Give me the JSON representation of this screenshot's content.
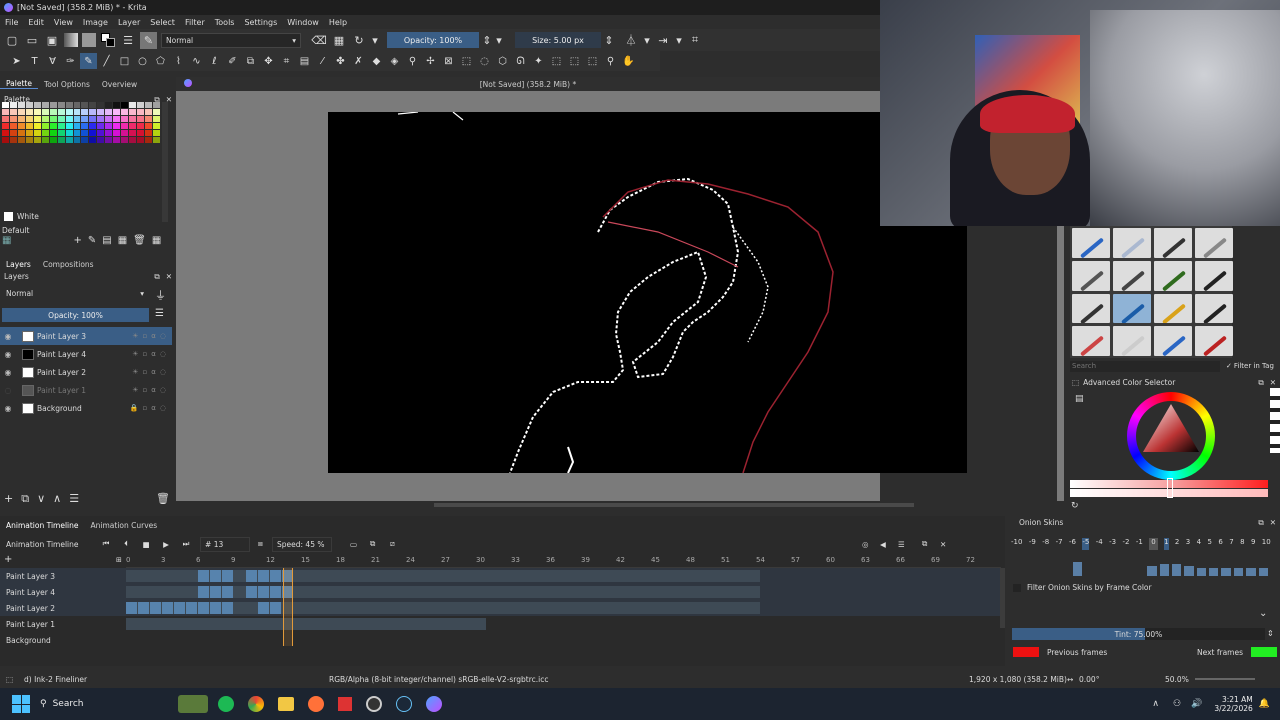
{
  "window": {
    "title": "[Not Saved]  (358.2 MiB) * - Krita"
  },
  "menu": [
    "File",
    "Edit",
    "View",
    "Image",
    "Layer",
    "Select",
    "Filter",
    "Tools",
    "Settings",
    "Window",
    "Help"
  ],
  "toolbar": {
    "blend_mode": "Normal",
    "opacity": "Opacity: 100%",
    "size": "Size: 5.00 px"
  },
  "docker_tabs": [
    "Palette",
    "Tool Options",
    "Overview"
  ],
  "palette": {
    "title": "Palette",
    "current_color": "White",
    "palette_name": "Default"
  },
  "layers_tabs": [
    "Layers",
    "Compositions"
  ],
  "layers_panel": {
    "title": "Layers",
    "blend": "Normal",
    "opacity": "Opacity: 100%"
  },
  "layers": [
    {
      "name": "Paint Layer 3",
      "active": true,
      "visible": true
    },
    {
      "name": "Paint Layer 4",
      "active": false,
      "visible": true
    },
    {
      "name": "Paint Layer 2",
      "active": false,
      "visible": true
    },
    {
      "name": "Paint Layer 1",
      "active": false,
      "visible": false
    },
    {
      "name": "Background",
      "active": false,
      "visible": true
    }
  ],
  "canvas_tab": "[Not Saved]  (358.2 MiB) *",
  "timeline": {
    "tabs": [
      "Animation Timeline",
      "Animation Curves"
    ],
    "title": "Animation Timeline",
    "frame": "13",
    "speed": "Speed: 45 %",
    "ruler": [
      "0",
      "3",
      "6",
      "9",
      "12",
      "15",
      "18",
      "21",
      "24",
      "27",
      "30",
      "33",
      "36",
      "39",
      "42",
      "45",
      "48",
      "51",
      "54",
      "57",
      "60",
      "63",
      "66",
      "69",
      "72"
    ],
    "rows": [
      "Paint Layer 3",
      "Paint Layer 4",
      "Paint Layer 2",
      "Paint Layer 1",
      "Background"
    ]
  },
  "brush_search": {
    "placeholder": "Search",
    "filter_label": "Filter in Tag"
  },
  "color_selector": {
    "title": "Advanced Color Selector"
  },
  "onion": {
    "title": "Onion Skins",
    "numbers": [
      "-10",
      "-9",
      "-8",
      "-7",
      "-6",
      "-5",
      "-4",
      "-3",
      "-2",
      "-1",
      "0",
      "1",
      "2",
      "3",
      "4",
      "5",
      "6",
      "7",
      "8",
      "9",
      "10"
    ],
    "filter_label": "Filter Onion Skins by Frame Color",
    "tint": "Tint: 75.00%",
    "tint_fraction": 0.75,
    "previous_label": "Previous frames",
    "next_label": "Next frames",
    "previous_color": "#ee1111",
    "next_color": "#22ee22"
  },
  "status": {
    "brush": "d) Ink-2 Fineliner",
    "colorspace": "RGB/Alpha (8-bit integer/channel)  sRGB-elle-V2-srgbtrc.icc",
    "dims": "1,920 x 1,080 (358.2 MiB)",
    "rotation": "0.00°",
    "zoom": "50.0%"
  },
  "taskbar": {
    "search": "Search",
    "time": "3:21 AM",
    "date": "3/22/2026"
  }
}
